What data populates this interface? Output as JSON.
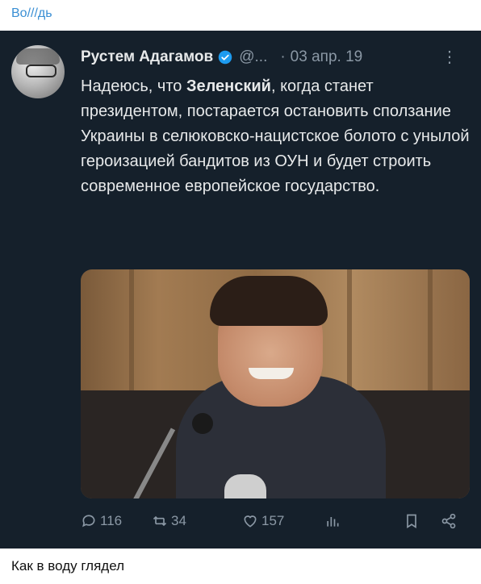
{
  "channel": {
    "name": "Во///дь"
  },
  "tweet": {
    "author": "Рустем Адагамов",
    "handle": "@...",
    "separator": "·",
    "date": "03 апр. 19",
    "more": "⋮",
    "text_before": "Надеюсь, что ",
    "text_bold": "Зеленский",
    "text_after": ", когда станет президентом, постарается остановить сползание Украины в селюковско-нацистское болото с унылой героизацией бандитов из ОУН и будет строить современное европейское государство.",
    "stats": {
      "replies": "116",
      "retweets": "34",
      "likes": "157"
    }
  },
  "caption": "Как в воду глядел",
  "colors": {
    "tweet_bg": "#15202b",
    "verified": "#1d9bf0",
    "channel": "#3a8fd4"
  },
  "icons": [
    "reply-icon",
    "retweet-icon",
    "like-icon",
    "stats-icon",
    "bookmark-icon",
    "share-icon",
    "verified-icon"
  ]
}
